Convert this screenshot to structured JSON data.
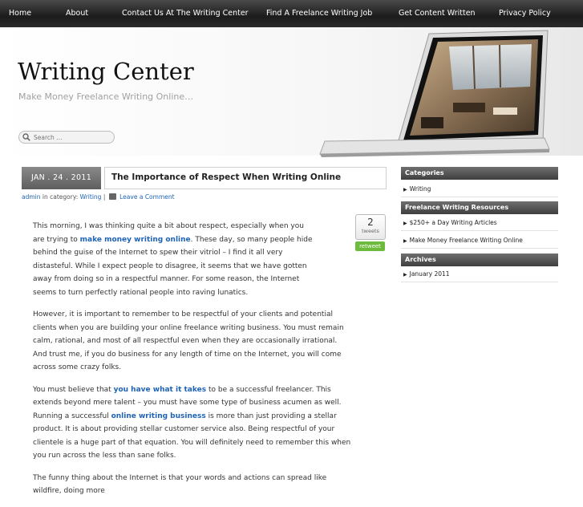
{
  "nav": {
    "items": [
      "Home",
      "About",
      "Contact Us At The Writing Center",
      "Find A Freelance Writing Job",
      "Get Content Written",
      "Privacy Policy"
    ]
  },
  "header": {
    "title": "Writing Center",
    "tagline": "Make Money Freelance Writing Online…",
    "search_placeholder": "Search …"
  },
  "post": {
    "date": "JAN . 24 . 2011",
    "title": "The Importance of Respect When Writing Online",
    "meta": {
      "author": "admin",
      "in_category": "in category:",
      "category": "Writing",
      "separator": "|",
      "comment_link": "Leave a Comment"
    },
    "tweet": {
      "count": "2",
      "label": "tweets",
      "retweet": "retweet"
    },
    "paragraphs": [
      {
        "p1a": "This morning, I was thinking quite a bit about respect, especially when you are trying to ",
        "link1": "make money writing online",
        "p1b": ".  These day, so many people hide behind the guise of the Internet to spew their vitriol – I find it all very distasteful.  While I expect people to disagree, it seems that we have gotten away from doing so in a respectful manner.  For some reason, the Internet seems to turn perfectly rational people into raving lunatics."
      },
      {
        "text": "However, it is important to remember to be respectful of your clients and potential clients when you are building your online freelance writing business.  You must remain calm, rational, and most of all respectful even when they are occasionally irrational.  And trust me, if you do business for any length of time on the Internet, you will come across some crazy folks."
      },
      {
        "p3a": "You must believe that ",
        "link1": "you have what it takes",
        "p3b": " to be a successful freelancer.  This extends beyond mere talent – you must have some type of business acumen as well.  Running a successful ",
        "link2": "online writing business",
        "p3c": " is more than just providing a stellar product.  It is about providing stellar customer service also.  Being respectful of your clientele is a huge part of that equation.  You will definitely need to remember this when you run across the less than sane folks."
      },
      {
        "text": "The funny thing about the Internet is that your words and actions can spread like wildfire, doing more"
      }
    ]
  },
  "sidebar": {
    "categories": {
      "title": "Categories",
      "items": [
        "Writing"
      ]
    },
    "resources": {
      "title": "Freelance Writing Resources",
      "items": [
        "$250+ a Day Writing Articles",
        "Make Money Freelance Writing Online"
      ]
    },
    "archives": {
      "title": "Archives",
      "items": [
        "January 2011"
      ]
    }
  },
  "colors": {
    "link": "#1f63b6",
    "nav_bg": "#1c1c1c",
    "retweet": "#6dbb3c"
  }
}
